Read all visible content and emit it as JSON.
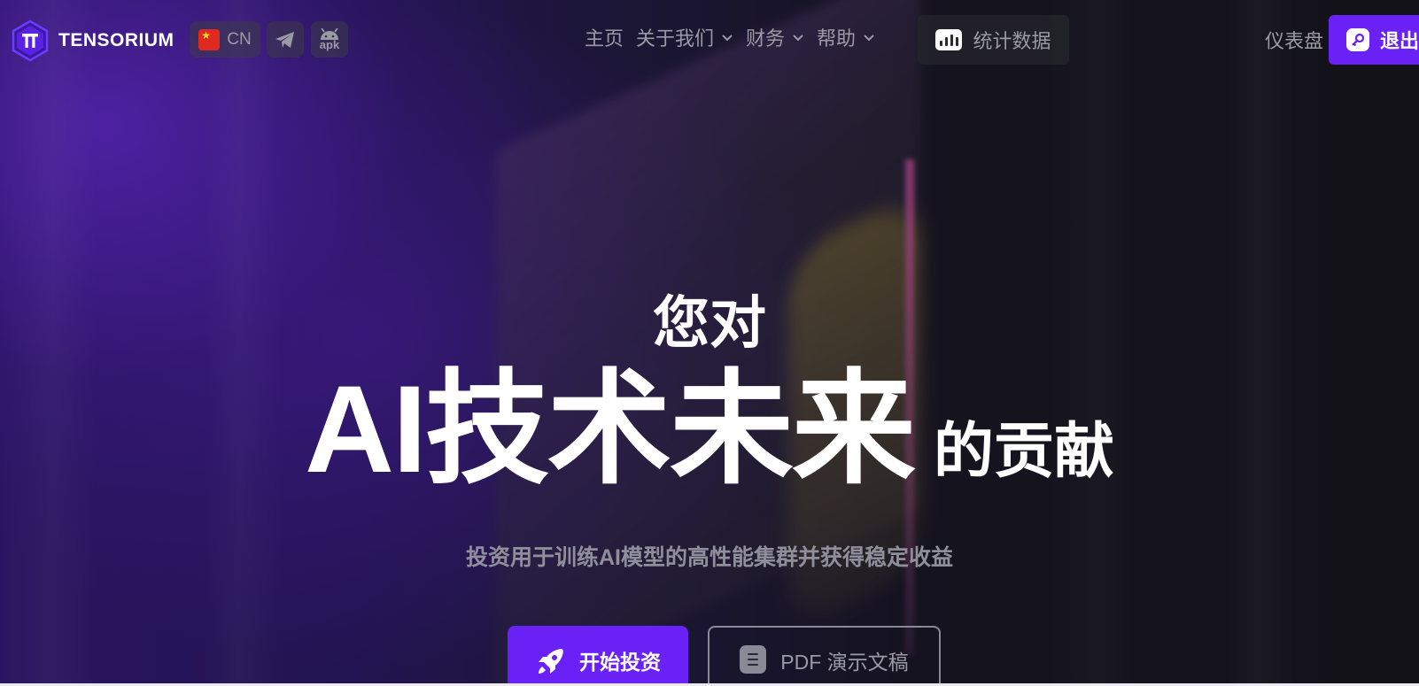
{
  "header": {
    "brand": "TENSORIUM",
    "language": {
      "code": "CN",
      "flag_icon": "china-flag-icon"
    },
    "telegram_icon": "telegram-icon",
    "apk": {
      "icon": "android-icon",
      "label": "apk"
    },
    "nav": [
      {
        "label": "主页",
        "has_dropdown": false
      },
      {
        "label": "关于我们",
        "has_dropdown": true
      },
      {
        "label": "财务",
        "has_dropdown": true
      },
      {
        "label": "帮助",
        "has_dropdown": true
      }
    ],
    "stats_label": "统计数据",
    "dashboard_label": "仪表盘",
    "logout_label": "退出"
  },
  "hero": {
    "line1": "您对",
    "line2_big": "AI技术未来",
    "line2_small": "的贡献",
    "subtitle": "投资用于训练AI模型的高性能集群并获得稳定收益",
    "cta_primary": "开始投资",
    "cta_secondary": "PDF 演示文稿"
  },
  "colors": {
    "accent": "#6a21f5",
    "text_muted": "#9a9aa5",
    "background": "#120f1c"
  }
}
